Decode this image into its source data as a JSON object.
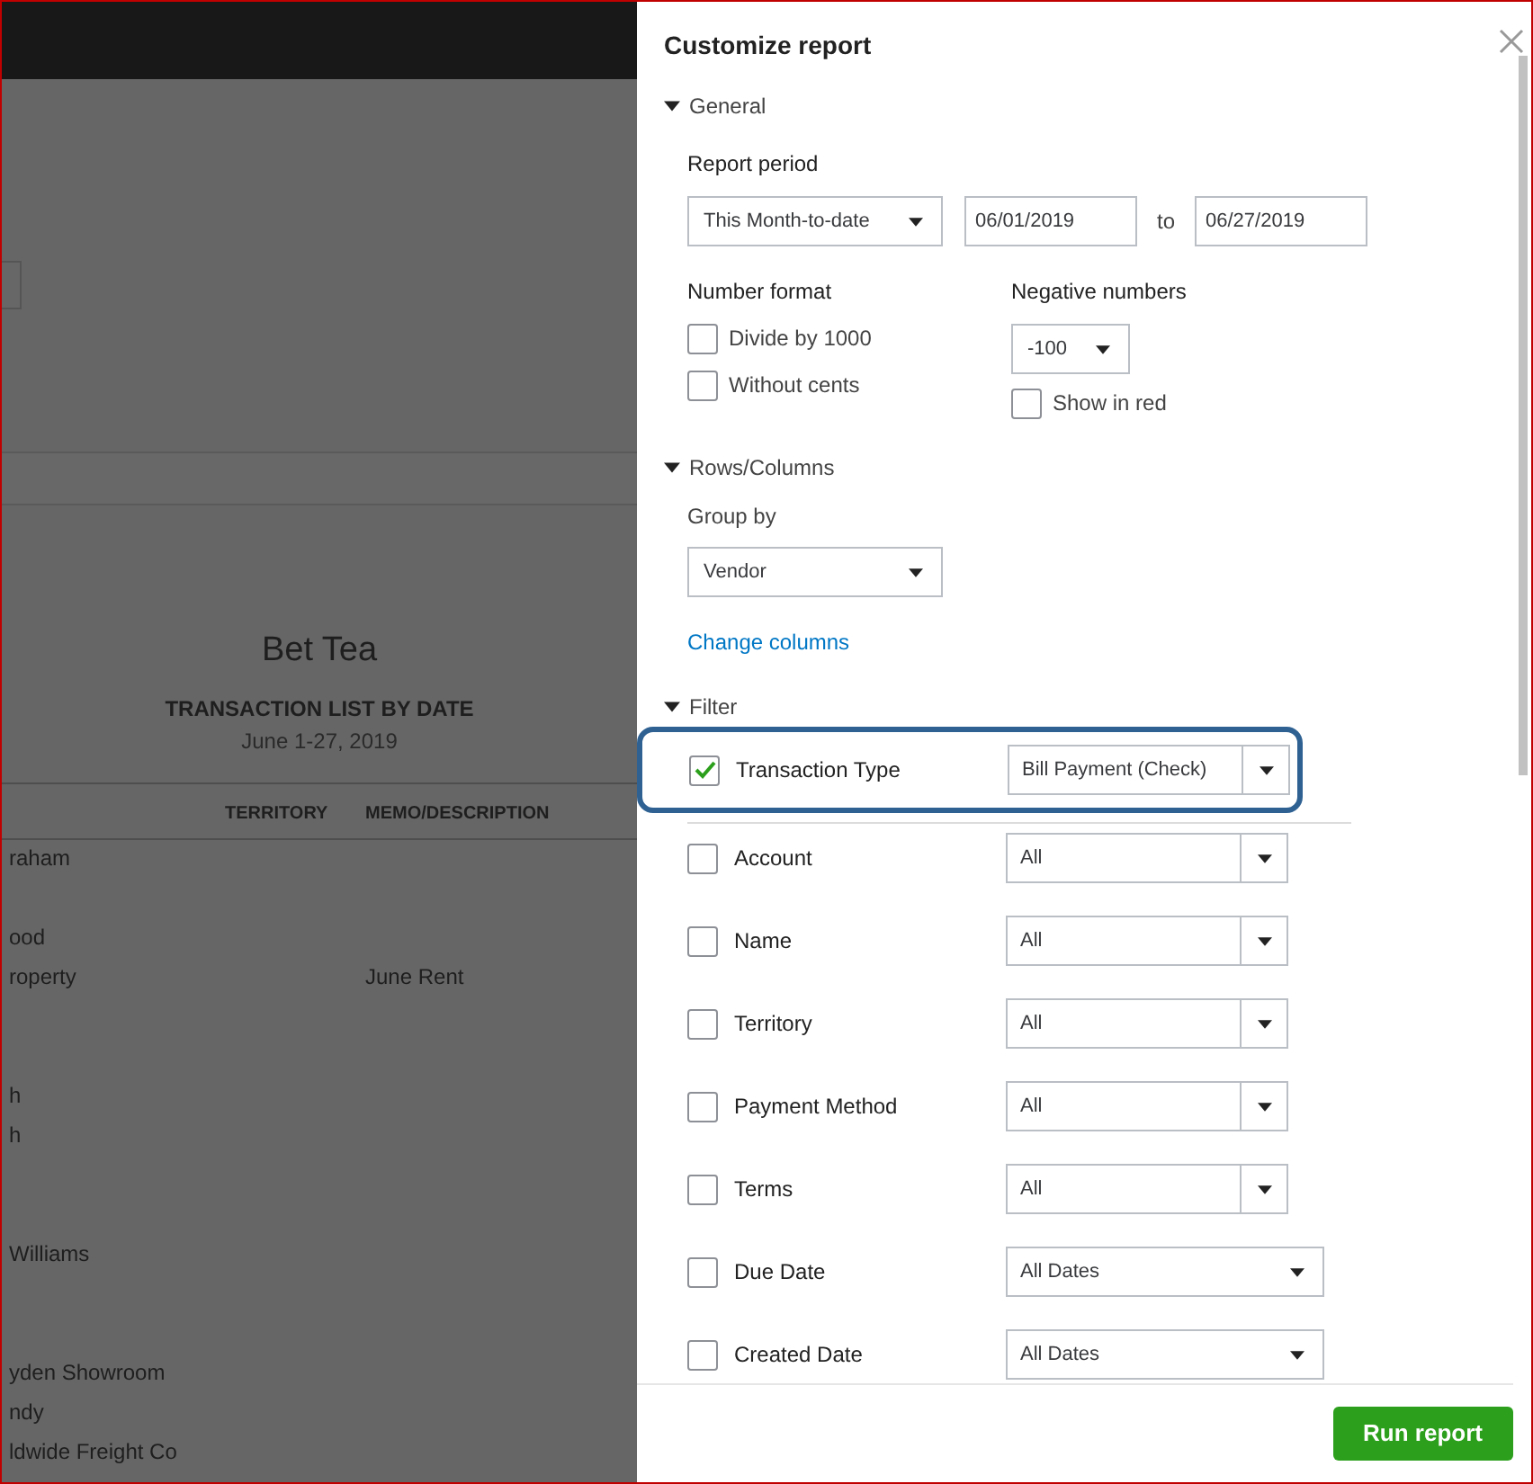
{
  "report": {
    "company": "Bet Tea",
    "title": "TRANSACTION LIST BY DATE",
    "date_range": "June 1-27, 2019",
    "columns": [
      "TERRITORY",
      "MEMO/DESCRIPTION"
    ],
    "rows": [
      {
        "column_1": "raham"
      },
      {
        "column_1": "ood"
      },
      {
        "column_1": "roperty",
        "memo": "June Rent"
      },
      {
        "column_1": "h"
      },
      {
        "column_1": "h"
      },
      {
        "column_1": "Williams"
      },
      {
        "column_1": "yden Showroom"
      },
      {
        "column_1": "ndy"
      },
      {
        "column_1": "ldwide Freight Co"
      }
    ]
  },
  "panel": {
    "title": "Customize report",
    "general": {
      "label": "General",
      "expanded": true,
      "report_period_label": "Report period",
      "period": "This Month-to-date",
      "from_date": "06/01/2019",
      "to_label": "to",
      "to_date": "06/27/2019",
      "number_format_label": "Number format",
      "number_format": [
        {
          "label": "Divide by 1000",
          "checked": false
        },
        {
          "label": "Without cents",
          "checked": false
        }
      ],
      "negative_numbers_label": "Negative numbers",
      "negative_format": "-100",
      "show_in_red": {
        "label": "Show in red",
        "checked": false
      }
    },
    "rows_columns": {
      "label": "Rows/Columns",
      "expanded": true,
      "group_by_label": "Group by",
      "group_by": "Vendor",
      "change_columns": "Change columns"
    },
    "filter": {
      "label": "Filter",
      "expanded": true,
      "items": [
        {
          "label": "Transaction Type",
          "checked": true,
          "highlighted": true,
          "kind": "split",
          "value": "Bill Payment (Check)"
        },
        {
          "label": "Account",
          "checked": false,
          "highlighted": false,
          "kind": "split",
          "value": "All"
        },
        {
          "label": "Name",
          "checked": false,
          "highlighted": false,
          "kind": "split",
          "value": "All"
        },
        {
          "label": "Territory",
          "checked": false,
          "highlighted": false,
          "kind": "split",
          "value": "All"
        },
        {
          "label": "Payment Method",
          "checked": false,
          "highlighted": false,
          "kind": "split",
          "value": "All"
        },
        {
          "label": "Terms",
          "checked": false,
          "highlighted": false,
          "kind": "split",
          "value": "All"
        },
        {
          "label": "Due Date",
          "checked": false,
          "highlighted": false,
          "kind": "date",
          "value": "All Dates"
        },
        {
          "label": "Created Date",
          "checked": false,
          "highlighted": false,
          "kind": "date",
          "value": "All Dates"
        }
      ]
    },
    "run_button": "Run report"
  }
}
